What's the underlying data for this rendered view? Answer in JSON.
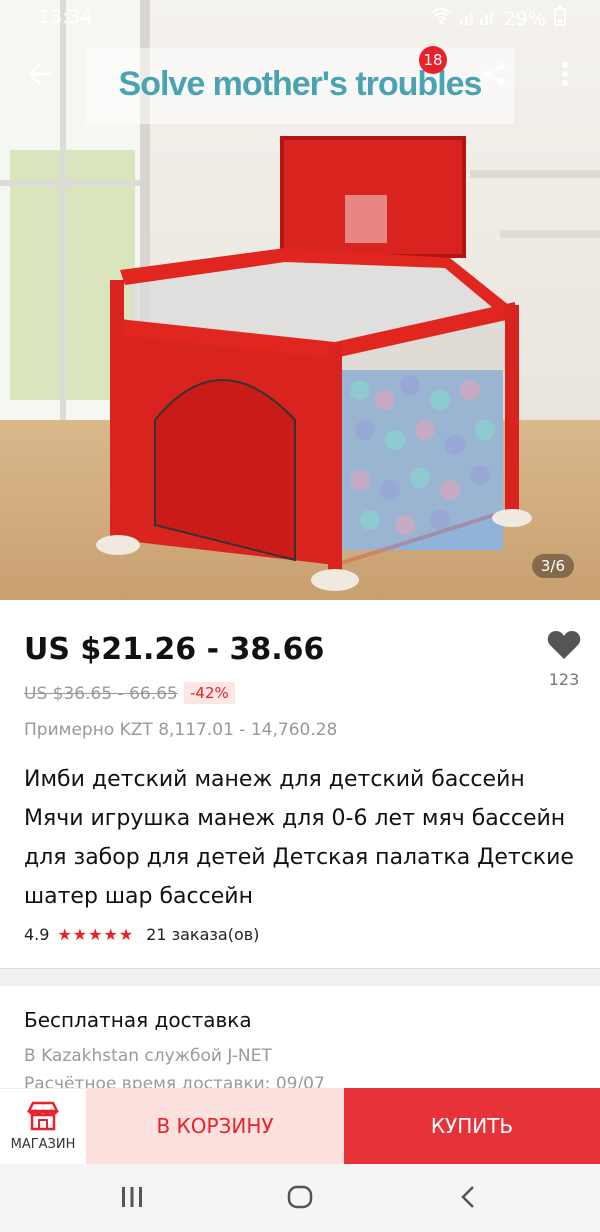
{
  "status_bar": {
    "time": "13:34",
    "battery": "29%"
  },
  "hero": {
    "banner_text": "Solve mother's troubles",
    "cart_badge": "18",
    "counter": "3/6"
  },
  "price": {
    "current": "US $21.26 - 38.66",
    "original": "US $36.65 - 66.65",
    "discount": "-42%",
    "approx": "Примерно KZT 8,117.01 - 14,760.28"
  },
  "favorites": {
    "count": "123"
  },
  "product": {
    "title": "Имби детский манеж для детский бассейн Мячи игрушка манеж для 0-6 лет мяч бассейн для забор для детей Детская палатка Детские шатер шар бассейн",
    "rating": "4.9",
    "stars": "★★★★★",
    "orders": "21 заказа(ов)"
  },
  "shipping": {
    "title": "Бесплатная доставка",
    "via": "В Kazakhstan службой J-NET",
    "estimate": "Расчётное время доставки: 09/07"
  },
  "bottom_bar": {
    "store_label": "МАГАЗИН",
    "cart_label": "В КОРЗИНУ",
    "buy_label": "КУПИТЬ"
  },
  "icons": [
    "back-arrow-icon",
    "share-icon",
    "more-vert-icon",
    "wifi-icon",
    "signal-icon",
    "heart-icon",
    "store-icon",
    "recent-apps-icon",
    "home-icon",
    "nav-back-icon"
  ],
  "colors": {
    "accent": "#e8212b",
    "cart_bg": "#fde1df",
    "banner_text": "#4aa3b3"
  }
}
